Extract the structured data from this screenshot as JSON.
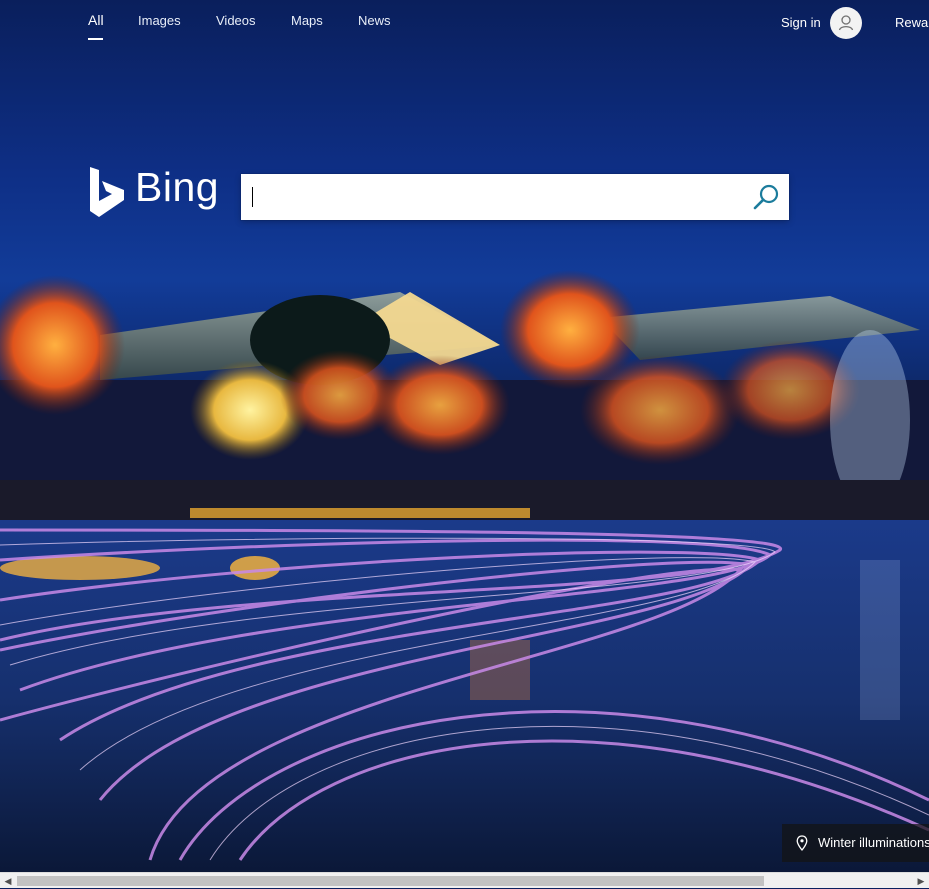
{
  "nav": {
    "items": [
      {
        "label": "All",
        "active": true
      },
      {
        "label": "Images"
      },
      {
        "label": "Videos"
      },
      {
        "label": "Maps"
      },
      {
        "label": "News"
      }
    ],
    "sign_in_label": "Sign in",
    "rewards_label": "Rewards"
  },
  "logo": {
    "word": "Bing"
  },
  "search": {
    "value": "",
    "placeholder": ""
  },
  "background": {
    "caption": "Winter illuminations"
  },
  "colors": {
    "nav_text": "#ffffff",
    "search_icon": "#1b7c9c",
    "caption_bg": "#141414"
  },
  "icons": {
    "avatar": "person-avatar-icon",
    "search": "magnifier-icon",
    "caption": "location-pin-icon"
  }
}
